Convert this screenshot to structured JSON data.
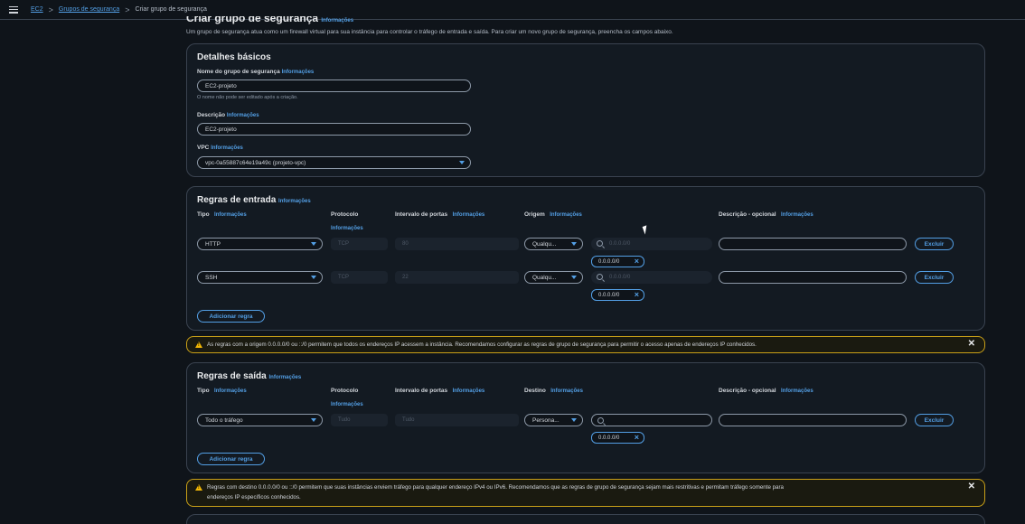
{
  "breadcrumb": {
    "ec2": "EC2",
    "groups": "Grupos de segurança",
    "current": "Criar grupo de segurança",
    "sep": ">"
  },
  "page": {
    "title": "Criar grupo de segurança",
    "info": "Informações",
    "intro": "Um grupo de segurança atua como um firewall virtual para sua instância para controlar o tráfego de entrada e saída. Para criar um novo grupo de segurança, preencha os campos abaixo."
  },
  "basic": {
    "title": "Detalhes básicos",
    "name_label": "Nome do grupo de segurança",
    "name_value": "EC2-projeto",
    "name_help": "O nome não pode ser editado após a criação.",
    "desc_label": "Descrição",
    "desc_value": "EC2-projeto",
    "vpc_label": "VPC",
    "vpc_value": "vpc-0a55887c64e19a49c (projeto-vpc)"
  },
  "columns": {
    "type": "Tipo",
    "protocol": "Protocolo",
    "port_range": "Intervalo de portas",
    "origin": "Origem",
    "destination": "Destino",
    "description": "Descrição - opcional",
    "info": "Informações"
  },
  "inbound": {
    "title": "Regras de entrada",
    "rules": [
      {
        "type": "HTTP",
        "protocol": "TCP",
        "port": "80",
        "source": "Qualqu...",
        "search": "0.0.0.0/0",
        "token": "0.0.0.0/0",
        "delete": "Excluir"
      },
      {
        "type": "SSH",
        "protocol": "TCP",
        "port": "22",
        "source": "Qualqu...",
        "search": "0.0.0.0/0",
        "token": "0.0.0.0/0",
        "delete": "Excluir"
      }
    ],
    "add": "Adicionar regra"
  },
  "warning_in": {
    "text": "As regras com a origem 0.0.0.0/0 ou ::/0 permitem que todos os endereços IP acessem a instância. Recomendamos configurar as regras de grupo de segurança para permitir o acesso apenas de endereços IP conhecidos.",
    "close": "✕"
  },
  "outbound": {
    "title": "Regras de saída",
    "rules": [
      {
        "type": "Todo o tráfego",
        "protocol": "Tudo",
        "port": "Tudo",
        "dest": "Persona...",
        "token": "0.0.0.0/0",
        "delete": "Excluir"
      }
    ],
    "add": "Adicionar regra"
  },
  "warning_out": {
    "text1": "Regras com destino 0.0.0.0/0 ou ::/0 permitem que suas instâncias enviem tráfego para qualquer endereço IPv4 ou IPv6. Recomendamos que as regras de grupo de segurança sejam mais restritivas e permitam tráfego somente para",
    "text2": "endereços IP específicos conhecidos.",
    "close": "✕"
  },
  "colors": {
    "accent": "#539fe5",
    "warning": "#f2b705",
    "bg": "#0f141a"
  },
  "icons": [
    "menu-icon",
    "search-icon",
    "close-icon",
    "warning-icon",
    "caret-down-icon"
  ]
}
